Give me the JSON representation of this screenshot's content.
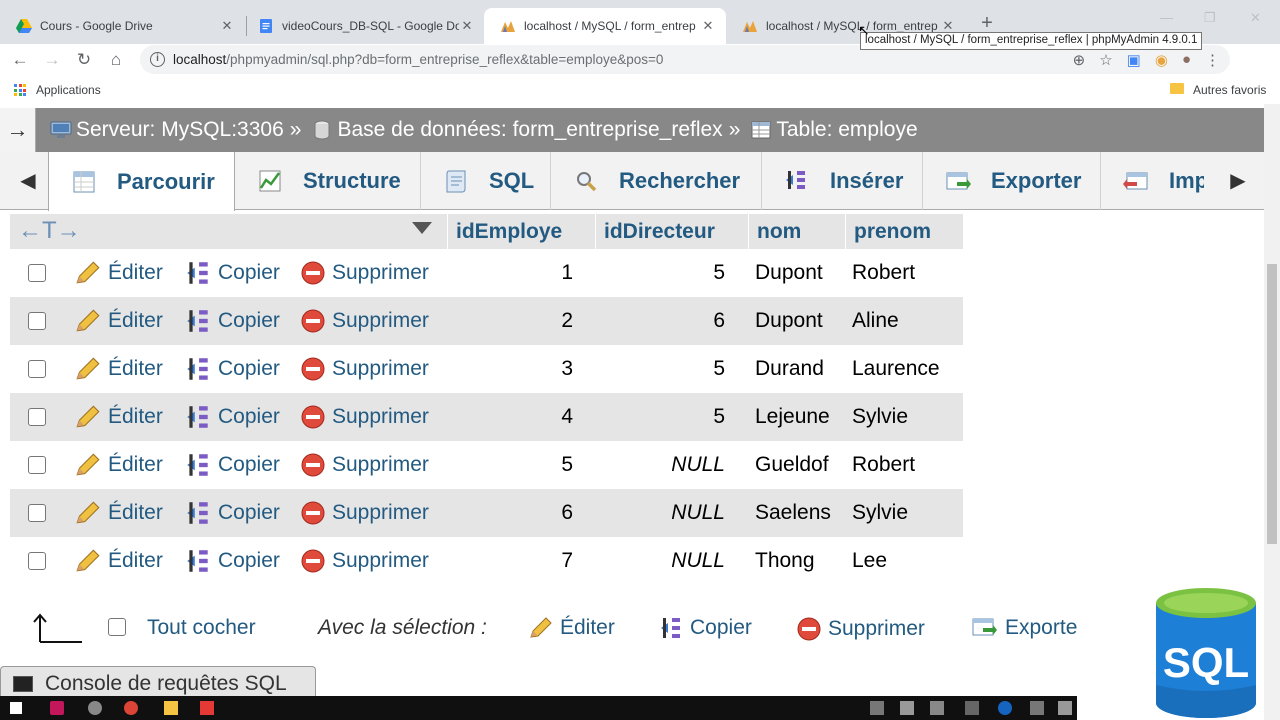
{
  "browser": {
    "tabs": [
      {
        "title": "Cours - Google Drive",
        "icon": "google-drive-icon",
        "active": false
      },
      {
        "title": "videoCours_DB-SQL - Google Do",
        "icon": "google-docs-icon",
        "active": false
      },
      {
        "title": "localhost / MySQL / form_entrep",
        "icon": "phpmyadmin-icon",
        "active": true
      },
      {
        "title": "localhost / MySQL / form_entrep",
        "icon": "phpmyadmin-icon",
        "active": false
      }
    ],
    "url_host": "localhost",
    "url_rest": "/phpmyadmin/sql.php?db=form_entreprise_reflex&table=employe&pos=0",
    "tooltip": "localhost / MySQL / form_entreprise_reflex | phpMyAdmin 4.9.0.1",
    "bookmarks": {
      "apps": "Applications",
      "favoris": "Autres favoris"
    }
  },
  "breadcrumb": {
    "server": "Serveur: MySQL:3306",
    "database": "Base de données: form_entreprise_reflex",
    "table": "Table: employe",
    "sep": "»"
  },
  "menu_tabs": [
    {
      "label": "Parcourir",
      "icon": "browse-icon",
      "active": true
    },
    {
      "label": "Structure",
      "icon": "structure-icon",
      "active": false
    },
    {
      "label": "SQL",
      "icon": "sql-icon",
      "active": false
    },
    {
      "label": "Rechercher",
      "icon": "search-icon",
      "active": false
    },
    {
      "label": "Insérer",
      "icon": "insert-icon",
      "active": false
    },
    {
      "label": "Exporter",
      "icon": "export-icon",
      "active": false
    },
    {
      "label": "Imp",
      "icon": "import-icon",
      "active": false
    }
  ],
  "table": {
    "columns": [
      "idEmploye",
      "idDirecteur",
      "nom",
      "prenom"
    ],
    "actions": {
      "edit": "Éditer",
      "copy": "Copier",
      "delete": "Supprimer"
    },
    "rows": [
      {
        "idEmploye": "1",
        "idDirecteur": "5",
        "nom": "Dupont",
        "prenom": "Robert"
      },
      {
        "idEmploye": "2",
        "idDirecteur": "6",
        "nom": "Dupont",
        "prenom": "Aline"
      },
      {
        "idEmploye": "3",
        "idDirecteur": "5",
        "nom": "Durand",
        "prenom": "Laurence"
      },
      {
        "idEmploye": "4",
        "idDirecteur": "5",
        "nom": "Lejeune",
        "prenom": "Sylvie"
      },
      {
        "idEmploye": "5",
        "idDirecteur": "NULL",
        "nom": "Gueldof",
        "prenom": "Robert"
      },
      {
        "idEmploye": "6",
        "idDirecteur": "NULL",
        "nom": "Saelens",
        "prenom": "Sylvie"
      },
      {
        "idEmploye": "7",
        "idDirecteur": "NULL",
        "nom": "Thong",
        "prenom": "Lee"
      }
    ]
  },
  "selection_bar": {
    "check_all": "Tout cocher",
    "with_selection": "Avec la sélection :",
    "edit": "Éditer",
    "copy": "Copier",
    "delete": "Supprimer",
    "export": "Exporte"
  },
  "console": {
    "label": "Console de requêtes SQL"
  },
  "logo_text": "SQL",
  "colors": {
    "link": "#235a81",
    "breadcrumb_bg": "#888888",
    "row_alt": "#e5e5e5"
  }
}
